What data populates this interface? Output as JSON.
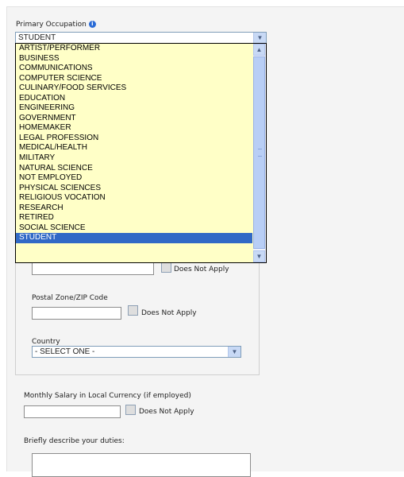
{
  "occupation": {
    "label": "Primary Occupation",
    "help_icon": "info-icon",
    "selected_value": "STUDENT",
    "options": [
      "ARTIST/PERFORMER",
      "BUSINESS",
      "COMMUNICATIONS",
      "COMPUTER SCIENCE",
      "CULINARY/FOOD SERVICES",
      "EDUCATION",
      "ENGINEERING",
      "GOVERNMENT",
      "HOMEMAKER",
      "LEGAL PROFESSION",
      "MEDICAL/HEALTH",
      "MILITARY",
      "NATURAL SCIENCE",
      "NOT EMPLOYED",
      "PHYSICAL SCIENCES",
      "RELIGIOUS VOCATION",
      "RESEARCH",
      "RETIRED",
      "SOCIAL SCIENCE",
      "STUDENT"
    ],
    "highlighted_option": "STUDENT"
  },
  "address": {
    "does_not_apply": "Does Not Apply",
    "postal_label": "Postal Zone/ZIP Code",
    "postal_does_not_apply": "Does Not Apply",
    "country_label": "Country",
    "country_selected": "- SELECT ONE -"
  },
  "salary": {
    "label": "Monthly Salary in Local Currency (if employed)",
    "does_not_apply": "Does Not Apply"
  },
  "duties": {
    "label": "Briefly describe your duties:"
  },
  "colors": {
    "dropdown_bg": "#ffffc7",
    "selection": "#3169c6",
    "page_bg": "#f4f4f4"
  }
}
